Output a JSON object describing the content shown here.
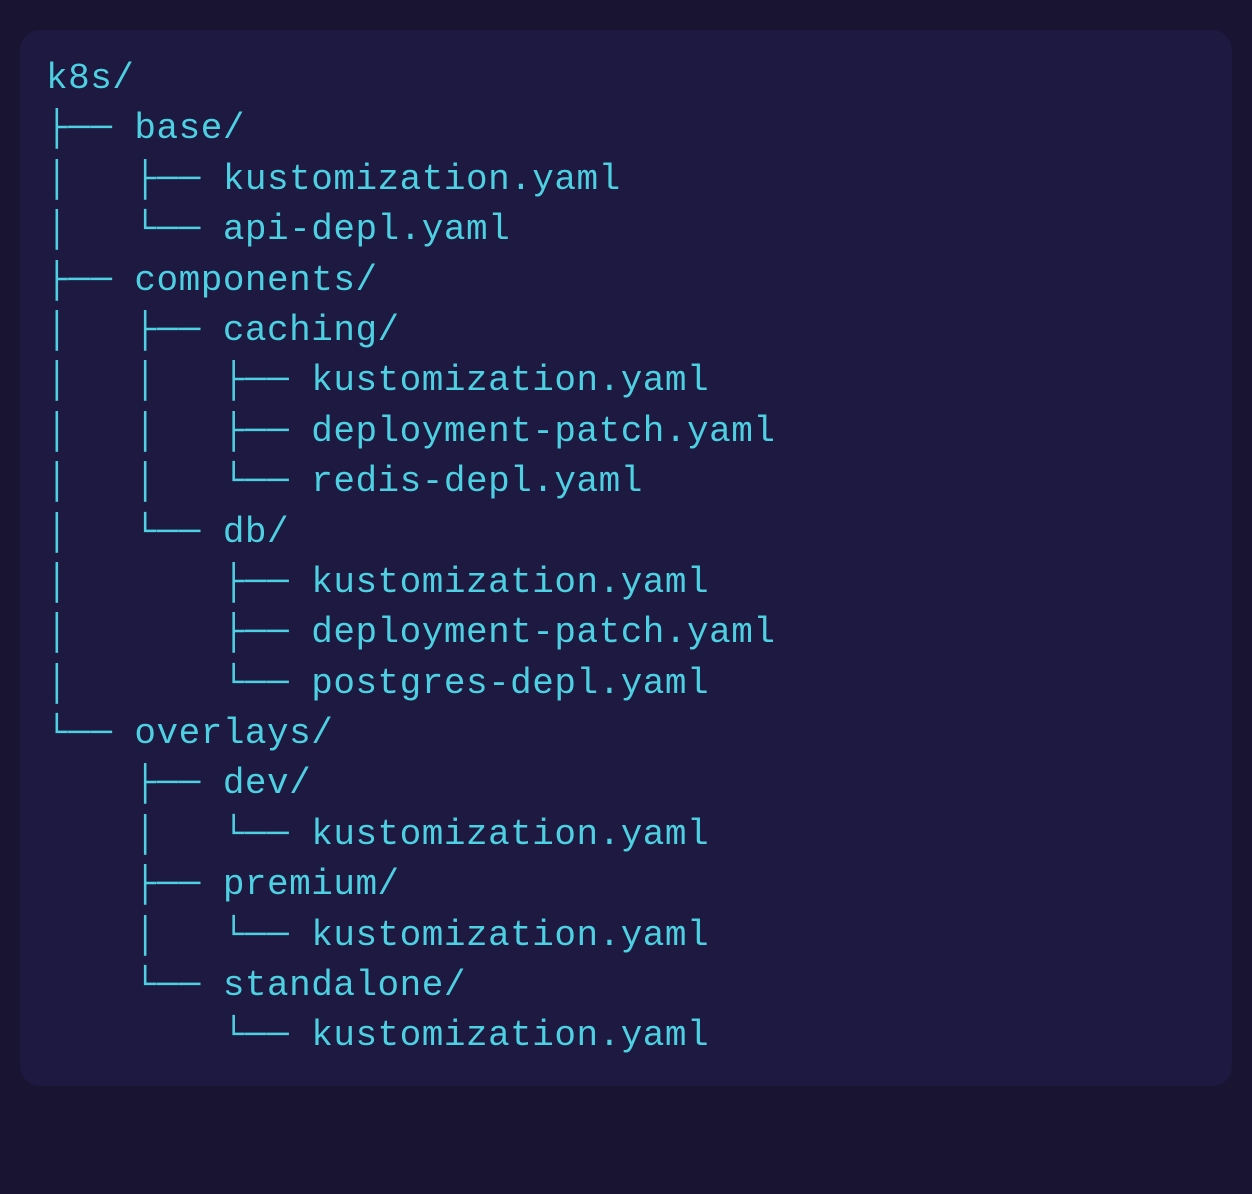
{
  "tree": {
    "root": "k8s/",
    "lines": [
      "├── base/",
      "│   ├── kustomization.yaml",
      "│   └── api-depl.yaml",
      "├── components/",
      "│   ├── caching/",
      "│   │   ├── kustomization.yaml",
      "│   │   ├── deployment-patch.yaml",
      "│   │   └── redis-depl.yaml",
      "│   └── db/",
      "│       ├── kustomization.yaml",
      "│       ├── deployment-patch.yaml",
      "│       └── postgres-depl.yaml",
      "└── overlays/",
      "    ├── dev/",
      "    │   └── kustomization.yaml",
      "    ├── premium/",
      "    │   └── kustomization.yaml",
      "    └── standalone/",
      "        └── kustomization.yaml"
    ]
  }
}
